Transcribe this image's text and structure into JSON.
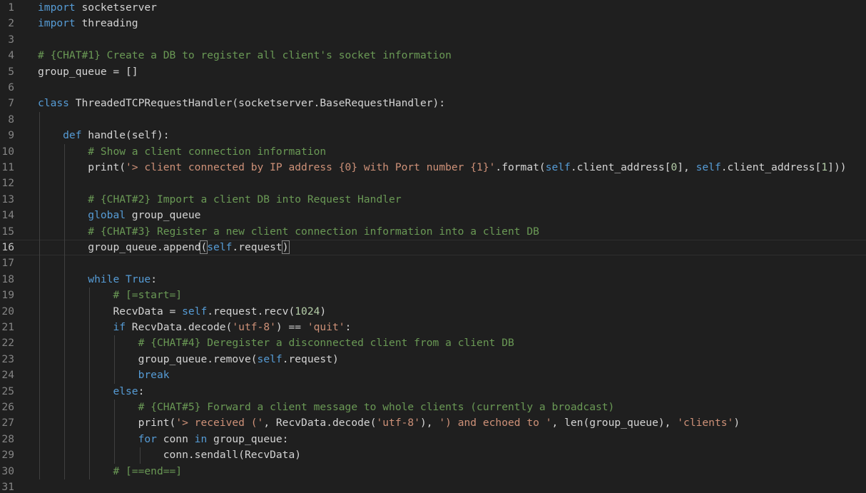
{
  "editor": {
    "active_line": 16,
    "lines": [
      {
        "n": "1",
        "indent": 0,
        "tokens": [
          [
            "kw",
            "import"
          ],
          [
            "id",
            " socketserver"
          ]
        ]
      },
      {
        "n": "2",
        "indent": 0,
        "tokens": [
          [
            "kw",
            "import"
          ],
          [
            "id",
            " threading"
          ]
        ]
      },
      {
        "n": "3",
        "indent": 0,
        "tokens": []
      },
      {
        "n": "4",
        "indent": 0,
        "tokens": [
          [
            "cm",
            "# {CHAT#1} Create a DB to register all client's socket information"
          ]
        ]
      },
      {
        "n": "5",
        "indent": 0,
        "tokens": [
          [
            "id",
            "group_queue = []"
          ]
        ]
      },
      {
        "n": "6",
        "indent": 0,
        "tokens": []
      },
      {
        "n": "7",
        "indent": 0,
        "tokens": [
          [
            "kw",
            "class"
          ],
          [
            "id",
            " ThreadedTCPRequestHandler(socketserver.BaseRequestHandler):"
          ]
        ]
      },
      {
        "n": "8",
        "indent": 0,
        "tokens": []
      },
      {
        "n": "9",
        "indent": 1,
        "tokens": [
          [
            "kw",
            "def"
          ],
          [
            "id",
            " handle(self):"
          ]
        ]
      },
      {
        "n": "10",
        "indent": 2,
        "tokens": [
          [
            "cm",
            "# Show a client connection information"
          ]
        ]
      },
      {
        "n": "11",
        "indent": 2,
        "tokens": [
          [
            "id",
            "print("
          ],
          [
            "str",
            "'> client connected by IP address {0} with Port number {1}'"
          ],
          [
            "id",
            ".format("
          ],
          [
            "self",
            "self"
          ],
          [
            "id",
            ".client_address["
          ],
          [
            "num",
            "0"
          ],
          [
            "id",
            "], "
          ],
          [
            "self",
            "self"
          ],
          [
            "id",
            ".client_address["
          ],
          [
            "num",
            "1"
          ],
          [
            "id",
            "]))"
          ]
        ]
      },
      {
        "n": "12",
        "indent": 2,
        "tokens": []
      },
      {
        "n": "13",
        "indent": 2,
        "tokens": [
          [
            "cm",
            "# {CHAT#2} Import a client DB into Request Handler"
          ]
        ]
      },
      {
        "n": "14",
        "indent": 2,
        "tokens": [
          [
            "kw",
            "global"
          ],
          [
            "id",
            " group_queue"
          ]
        ]
      },
      {
        "n": "15",
        "indent": 2,
        "tokens": [
          [
            "cm",
            "# {CHAT#3} Register a new client connection information into a client DB"
          ]
        ]
      },
      {
        "n": "16",
        "indent": 2,
        "tokens": [
          [
            "id",
            "group_queue.append"
          ],
          [
            "br",
            "("
          ],
          [
            "self",
            "self"
          ],
          [
            "id",
            ".request"
          ],
          [
            "br",
            ")"
          ]
        ]
      },
      {
        "n": "17",
        "indent": 2,
        "tokens": []
      },
      {
        "n": "18",
        "indent": 2,
        "tokens": [
          [
            "kw",
            "while"
          ],
          [
            "id",
            " "
          ],
          [
            "kw",
            "True"
          ],
          [
            "id",
            ":"
          ]
        ]
      },
      {
        "n": "19",
        "indent": 3,
        "tokens": [
          [
            "cm",
            "# [=start=]"
          ]
        ]
      },
      {
        "n": "20",
        "indent": 3,
        "tokens": [
          [
            "id",
            "RecvData = "
          ],
          [
            "self",
            "self"
          ],
          [
            "id",
            ".request.recv("
          ],
          [
            "num",
            "1024"
          ],
          [
            "id",
            ")"
          ]
        ]
      },
      {
        "n": "21",
        "indent": 3,
        "tokens": [
          [
            "kw",
            "if"
          ],
          [
            "id",
            " RecvData.decode("
          ],
          [
            "str",
            "'utf-8'"
          ],
          [
            "id",
            ") == "
          ],
          [
            "str",
            "'quit'"
          ],
          [
            "id",
            ":"
          ]
        ]
      },
      {
        "n": "22",
        "indent": 4,
        "tokens": [
          [
            "cm",
            "# {CHAT#4} Deregister a disconnected client from a client DB"
          ]
        ]
      },
      {
        "n": "23",
        "indent": 4,
        "tokens": [
          [
            "id",
            "group_queue.remove("
          ],
          [
            "self",
            "self"
          ],
          [
            "id",
            ".request)"
          ]
        ]
      },
      {
        "n": "24",
        "indent": 4,
        "tokens": [
          [
            "kw",
            "break"
          ]
        ]
      },
      {
        "n": "25",
        "indent": 3,
        "tokens": [
          [
            "kw",
            "else"
          ],
          [
            "id",
            ":"
          ]
        ]
      },
      {
        "n": "26",
        "indent": 4,
        "tokens": [
          [
            "cm",
            "# {CHAT#5} Forward a client message to whole clients (currently a broadcast)"
          ]
        ]
      },
      {
        "n": "27",
        "indent": 4,
        "tokens": [
          [
            "id",
            "print("
          ],
          [
            "str",
            "'> received ('"
          ],
          [
            "id",
            ", RecvData.decode("
          ],
          [
            "str",
            "'utf-8'"
          ],
          [
            "id",
            "), "
          ],
          [
            "str",
            "') and echoed to '"
          ],
          [
            "id",
            ", len(group_queue), "
          ],
          [
            "str",
            "'clients'"
          ],
          [
            "id",
            ")"
          ]
        ]
      },
      {
        "n": "28",
        "indent": 4,
        "tokens": [
          [
            "kw",
            "for"
          ],
          [
            "id",
            " conn "
          ],
          [
            "kw",
            "in"
          ],
          [
            "id",
            " group_queue:"
          ]
        ]
      },
      {
        "n": "29",
        "indent": 5,
        "tokens": [
          [
            "id",
            "conn.sendall(RecvData)"
          ]
        ]
      },
      {
        "n": "30",
        "indent": 3,
        "tokens": [
          [
            "cm",
            "# [==end==]"
          ]
        ]
      },
      {
        "n": "31",
        "indent": 0,
        "tokens": []
      }
    ]
  },
  "colors": {
    "background": "#1f1f1f",
    "keyword": "#569cd6",
    "string": "#ce9178",
    "comment": "#6a9955",
    "number": "#b5cea8",
    "identifier": "#d4d4d4",
    "line_number": "#858585"
  }
}
